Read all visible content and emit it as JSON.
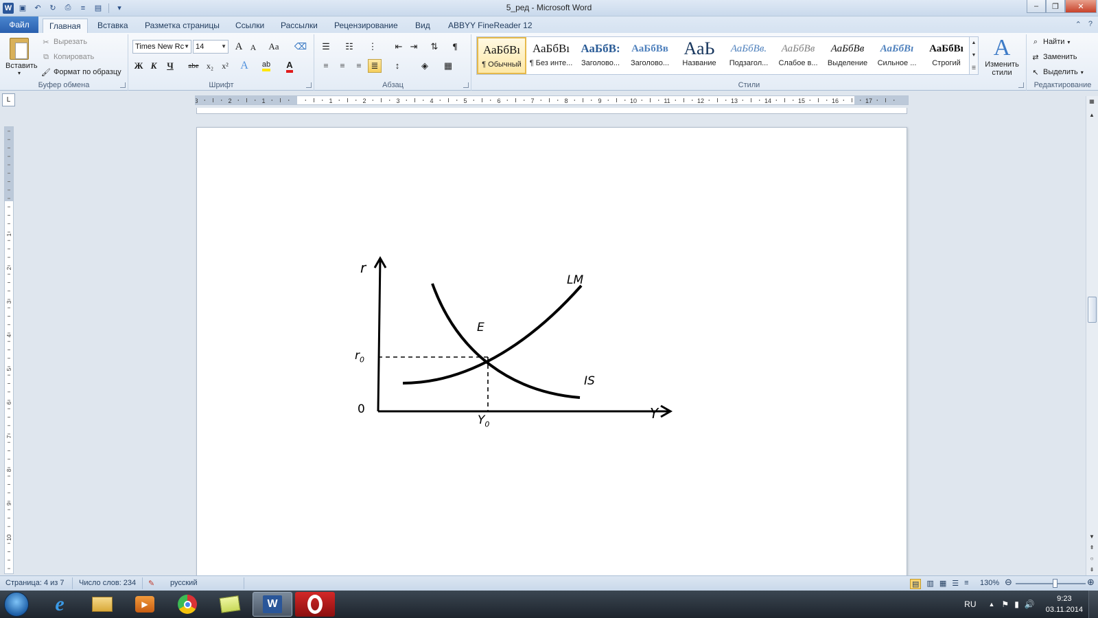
{
  "window": {
    "title": "5_ред - Microsoft Word",
    "min_icon": "minimize-icon",
    "max_icon": "restore-icon",
    "close_icon": "close-icon"
  },
  "tabs": [
    "Файл",
    "Главная",
    "Вставка",
    "Разметка страницы",
    "Ссылки",
    "Рассылки",
    "Рецензирование",
    "Вид",
    "ABBYY FineReader 12"
  ],
  "ribbon": {
    "clipboard": {
      "label": "Буфер обмена",
      "paste": "Вставить",
      "cut": "Вырезать",
      "copy": "Копировать",
      "format_painter": "Формат по образцу"
    },
    "font": {
      "label": "Шрифт",
      "family": "Times New Rc",
      "size": "14",
      "bold": "Ж",
      "italic": "К",
      "underline": "Ч",
      "strike": "abe",
      "sub": "x₂",
      "sup": "x²",
      "grow": "A",
      "shrink": "A",
      "case": "Aa"
    },
    "paragraph": {
      "label": "Абзац",
      "pilcrow": "¶"
    },
    "styles": {
      "label": "Стили",
      "items": [
        {
          "sample": "АаБбВı",
          "name": "¶ Обычный"
        },
        {
          "sample": "АаБбВı",
          "name": "¶ Без инте..."
        },
        {
          "sample": "АаБбВ:",
          "name": "Заголово..."
        },
        {
          "sample": "АаБбВв",
          "name": "Заголово..."
        },
        {
          "sample": "АаЬ",
          "name": "Название"
        },
        {
          "sample": "АаБбВв.",
          "name": "Подзагол..."
        },
        {
          "sample": "АаБбВв",
          "name": "Слабое в..."
        },
        {
          "sample": "АаБбВв",
          "name": "Выделение"
        },
        {
          "sample": "АаБбВı",
          "name": "Сильное ..."
        },
        {
          "sample": "АаБбВı",
          "name": "Строгий"
        }
      ],
      "change": "Изменить стили",
      "change_glyph": "A"
    },
    "editing": {
      "label": "Редактирование",
      "find": "Найти",
      "replace": "Заменить",
      "select": "Выделить"
    }
  },
  "ruler": {
    "tab_selector": "L",
    "h_labels": [
      "3",
      "2",
      "1",
      "1",
      "2",
      "3",
      "4",
      "5",
      "6",
      "7",
      "8",
      "9",
      "10",
      "11",
      "12",
      "13",
      "14",
      "15",
      "16",
      "17"
    ],
    "v_labels": [
      "1",
      "2",
      "3",
      "4",
      "5",
      "6",
      "7",
      "8",
      "9",
      "10"
    ]
  },
  "graph": {
    "y_axis_label": "r",
    "x_axis_label": "Y",
    "origin_label": "0",
    "equilibrium_label": "E",
    "r0_label": "r",
    "r0_sub": "0",
    "y0_label": "Y",
    "y0_sub": "0",
    "lm_label": "LM",
    "is_label": "IS"
  },
  "statusbar": {
    "page": "Страница: 4 из 7",
    "words": "Число слов: 234",
    "language": "русский",
    "zoom": "130%",
    "zoom_level_percent": 130
  },
  "taskbar": {
    "apps": [
      {
        "name": "ie",
        "icon": "internet-explorer-icon",
        "glyph": "e"
      },
      {
        "name": "explorer",
        "icon": "folder-icon",
        "glyph": ""
      },
      {
        "name": "media",
        "icon": "media-player-icon",
        "glyph": "▶"
      },
      {
        "name": "chrome",
        "icon": "chrome-icon",
        "glyph": ""
      },
      {
        "name": "notes",
        "icon": "sticky-notes-icon",
        "glyph": ""
      },
      {
        "name": "word",
        "icon": "word-icon",
        "glyph": "W"
      },
      {
        "name": "opera",
        "icon": "opera-icon",
        "glyph": "O"
      }
    ],
    "lang": "RU",
    "time": "9:23",
    "date": "03.11.2014"
  }
}
